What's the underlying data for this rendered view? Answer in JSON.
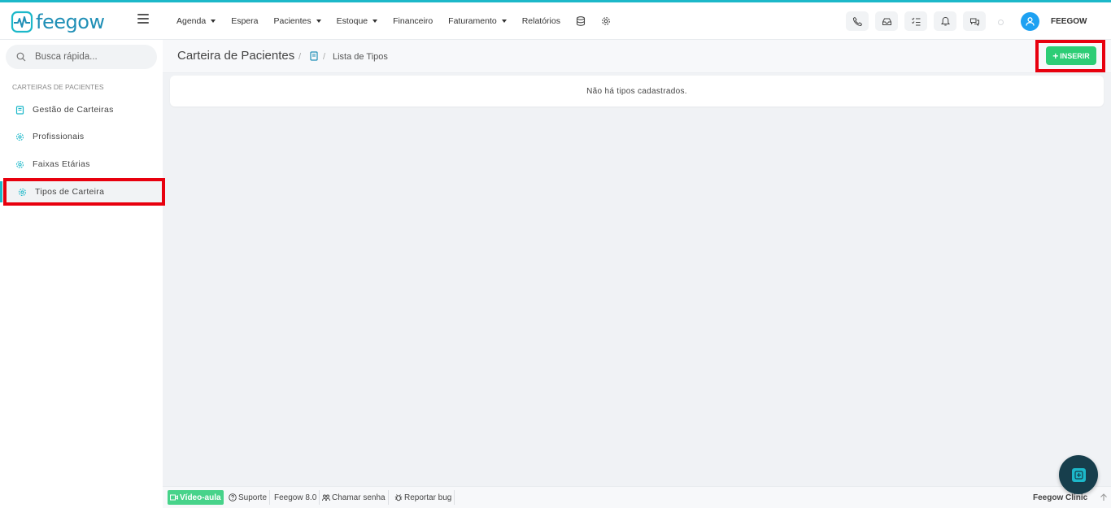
{
  "app": {
    "brand": "feegow",
    "accent": "#1cb8c9",
    "brand_color": "#1f8fb6"
  },
  "nav": {
    "menu": [
      {
        "label": "Agenda",
        "dropdown": true
      },
      {
        "label": "Espera",
        "dropdown": false
      },
      {
        "label": "Pacientes",
        "dropdown": true
      },
      {
        "label": "Estoque",
        "dropdown": true
      },
      {
        "label": "Financeiro",
        "dropdown": false
      },
      {
        "label": "Faturamento",
        "dropdown": true
      },
      {
        "label": "Relatórios",
        "dropdown": false
      }
    ],
    "extra_icons": [
      "database-icon",
      "gear-icon"
    ],
    "tools": [
      "phone-icon",
      "inbox-icon",
      "tasks-icon",
      "bell-icon",
      "chat-icon"
    ],
    "user": "FEEGOW"
  },
  "sidebar": {
    "search_placeholder": "Busca rápida...",
    "section_title": "CARTEIRAS DE PACIENTES",
    "items": [
      {
        "label": "Gestão de Carteiras",
        "icon": "book-icon",
        "active": false
      },
      {
        "label": "Profissionais",
        "icon": "gear-icon",
        "active": false
      },
      {
        "label": "Faixas Etárias",
        "icon": "gear-icon",
        "active": false
      },
      {
        "label": "Tipos de Carteira",
        "icon": "gear-icon",
        "active": true
      }
    ]
  },
  "content": {
    "title": "Carteira de Pacientes",
    "breadcrumb_current": "Lista de Tipos",
    "insert_label": "INSERIR",
    "empty_message": "Não há tipos cadastrados.",
    "insert_color": "#2dcd75"
  },
  "footer": {
    "video": "Vídeo-aula",
    "support": "Suporte",
    "version": "Feegow 8.0",
    "call": "Chamar senha",
    "bug": "Reportar bug",
    "brand": "Feegow Clinic"
  }
}
